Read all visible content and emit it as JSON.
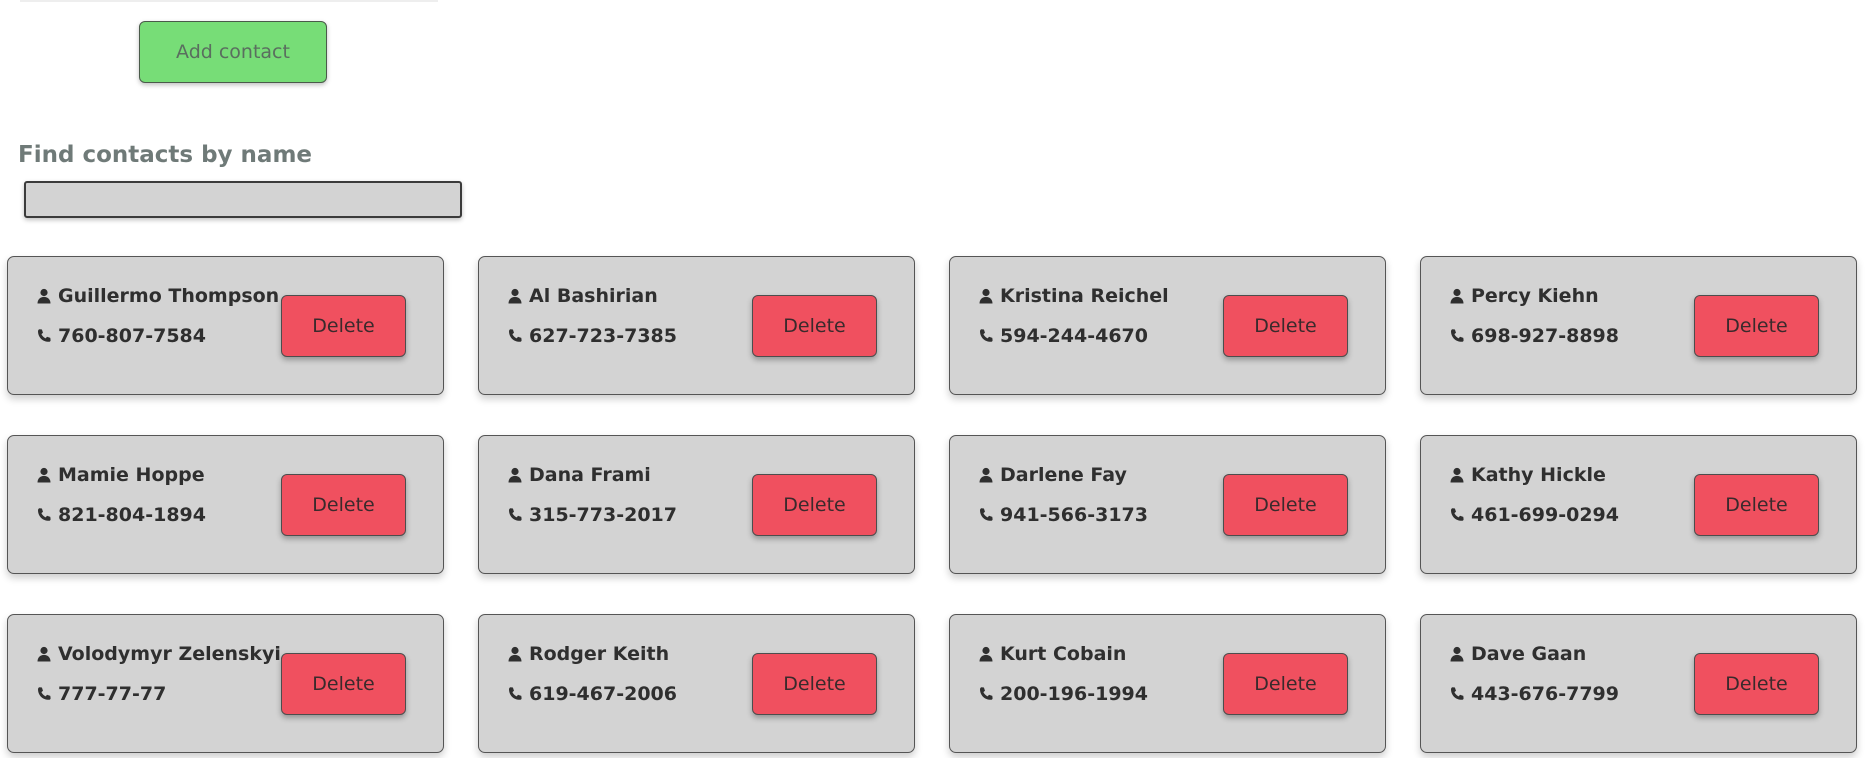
{
  "add_button": {
    "label": "Add contact",
    "color": "#77dd77"
  },
  "search": {
    "title": "Find contacts by name",
    "value": "",
    "placeholder": ""
  },
  "icons": {
    "name": "user-icon",
    "phone": "phone-icon"
  },
  "colors": {
    "card_bg": "#d3d3d3",
    "delete": "#f0505f"
  },
  "contacts": [
    {
      "name": "Guillermo Thompson",
      "phone": "760-807-7584",
      "delete_label": "Delete"
    },
    {
      "name": "Al Bashirian",
      "phone": "627-723-7385",
      "delete_label": "Delete"
    },
    {
      "name": "Kristina Reichel",
      "phone": "594-244-4670",
      "delete_label": "Delete"
    },
    {
      "name": "Percy Kiehn",
      "phone": "698-927-8898",
      "delete_label": "Delete"
    },
    {
      "name": "Mamie Hoppe",
      "phone": "821-804-1894",
      "delete_label": "Delete"
    },
    {
      "name": "Dana Frami",
      "phone": "315-773-2017",
      "delete_label": "Delete"
    },
    {
      "name": "Darlene Fay",
      "phone": "941-566-3173",
      "delete_label": "Delete"
    },
    {
      "name": "Kathy Hickle",
      "phone": "461-699-0294",
      "delete_label": "Delete"
    },
    {
      "name": "Volodymyr Zelenskyi",
      "phone": "777-77-77",
      "delete_label": "Delete"
    },
    {
      "name": "Rodger Keith",
      "phone": "619-467-2006",
      "delete_label": "Delete"
    },
    {
      "name": "Kurt Cobain",
      "phone": "200-196-1994",
      "delete_label": "Delete"
    },
    {
      "name": "Dave Gaan",
      "phone": "443-676-7799",
      "delete_label": "Delete"
    }
  ]
}
